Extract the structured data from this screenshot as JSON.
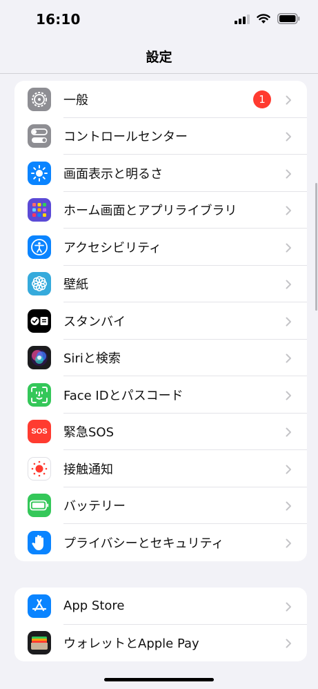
{
  "status": {
    "time": "16:10",
    "icons": [
      "signal-icon",
      "wifi-icon",
      "battery-icon"
    ]
  },
  "nav": {
    "title": "設定"
  },
  "groups": [
    {
      "items": [
        {
          "label": "一般",
          "icon": "gear-icon",
          "color": "#8e8e93",
          "badge": "1"
        },
        {
          "label": "コントロールセンター",
          "icon": "toggles-icon",
          "color": "#8e8e93"
        },
        {
          "label": "画面表示と明るさ",
          "icon": "sun-icon",
          "color": "#0a84ff"
        },
        {
          "label": "ホーム画面とアプリライブラリ",
          "icon": "app-grid-icon",
          "color": "#5b4ad6"
        },
        {
          "label": "アクセシビリティ",
          "icon": "accessibility-icon",
          "color": "#0a84ff"
        },
        {
          "label": "壁紙",
          "icon": "flower-icon",
          "color": "#35aadc"
        },
        {
          "label": "スタンバイ",
          "icon": "standby-icon",
          "color": "#000000"
        },
        {
          "label": "Siriと検索",
          "icon": "siri-icon",
          "color": "#1c1c1e"
        },
        {
          "label": "Face IDとパスコード",
          "icon": "face-id-icon",
          "color": "#34c759"
        },
        {
          "label": "緊急SOS",
          "icon": "sos-icon",
          "color": "#ff3b30",
          "icon_text": "SOS"
        },
        {
          "label": "接触通知",
          "icon": "exposure-icon",
          "color": "#ffffff"
        },
        {
          "label": "バッテリー",
          "icon": "battery-setting-icon",
          "color": "#34c759"
        },
        {
          "label": "プライバシーとセキュリティ",
          "icon": "hand-icon",
          "color": "#0a84ff"
        }
      ]
    },
    {
      "items": [
        {
          "label": "App Store",
          "icon": "app-store-icon",
          "color": "#0a84ff"
        },
        {
          "label": "ウォレットとApple Pay",
          "icon": "wallet-icon",
          "color": "#1c1c1e"
        }
      ]
    }
  ]
}
